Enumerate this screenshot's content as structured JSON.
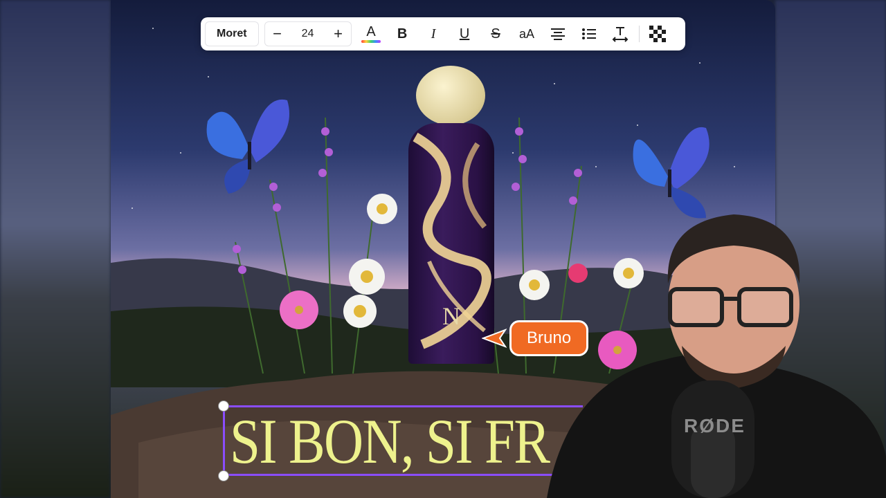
{
  "toolbar": {
    "font_name": "Moret",
    "decrease_label": "−",
    "font_size": "24",
    "increase_label": "+",
    "text_color_icon": "A",
    "bold_icon": "B",
    "italic_icon": "I",
    "underline_icon": "U",
    "strikethrough_icon": "S",
    "case_icon": "aA",
    "icons": [
      "text-color-icon",
      "bold-icon",
      "italic-icon",
      "underline-icon",
      "strikethrough-icon",
      "letter-case-icon",
      "align-center-icon",
      "bullet-list-icon",
      "text-spacing-icon",
      "transparency-icon"
    ]
  },
  "canvas": {
    "headline": "SI BON, SI FR",
    "bottle_monogram": "N"
  },
  "collaborator": {
    "name": "Bruno",
    "color": "#f06a23"
  },
  "webcam": {
    "mic_brand": "RØDE"
  },
  "colors": {
    "selection": "#8a4dff",
    "headline_text": "#eef28d"
  }
}
